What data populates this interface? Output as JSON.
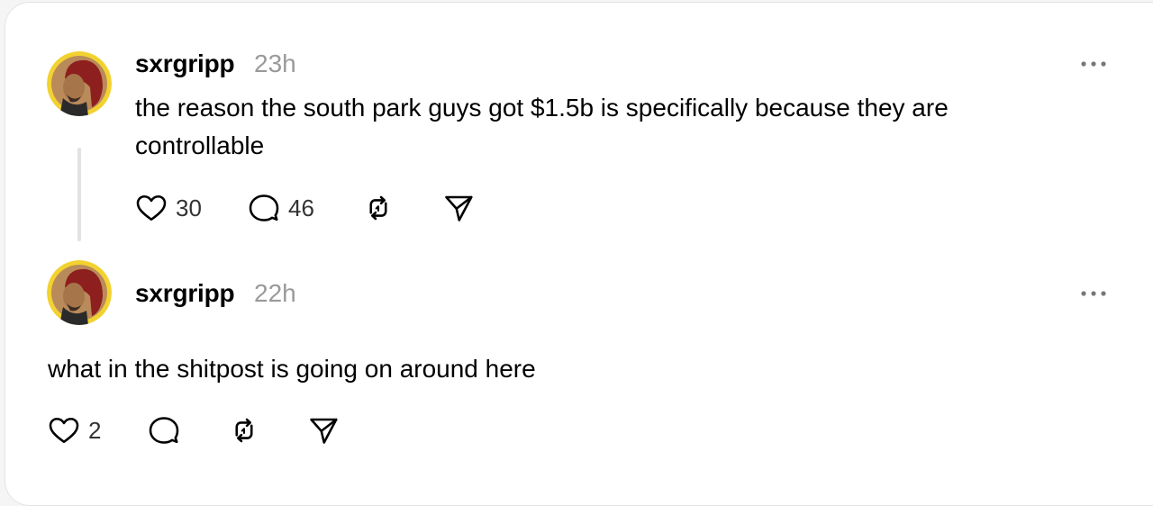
{
  "posts": [
    {
      "username": "sxrgripp",
      "timestamp": "23h",
      "text": "the reason the south park guys got $1.5b is specifically because they are controllable",
      "likes": "30",
      "replies": "46"
    },
    {
      "username": "sxrgripp",
      "timestamp": "22h",
      "text": "what in the shitpost is going on around here",
      "likes": "2"
    }
  ],
  "icons": {
    "more": "more-options-icon",
    "like": "heart-icon",
    "reply": "comment-icon",
    "repost": "repost-icon",
    "share": "send-icon"
  }
}
